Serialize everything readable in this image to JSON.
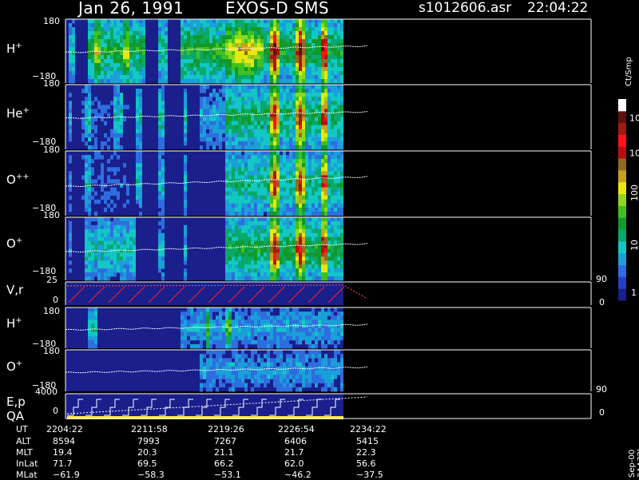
{
  "header": {
    "date": "Jan 26, 1991",
    "instrument": "EXOS-D SMS",
    "file": "s1012606.asr",
    "time": "22:04:22"
  },
  "panels": [
    {
      "id": "h1",
      "label": "H",
      "charge": "+",
      "tick_top": "180",
      "tick_bottom": "−180"
    },
    {
      "id": "he",
      "label": "He",
      "charge": "+",
      "tick_top": "180",
      "tick_bottom": "−180"
    },
    {
      "id": "opp",
      "label": "O",
      "charge": "++",
      "tick_top": "180",
      "tick_bottom": "−180"
    },
    {
      "id": "o1",
      "label": "O",
      "charge": "+",
      "tick_top": "180",
      "tick_bottom": "−180"
    },
    {
      "id": "vr",
      "label": "V,r",
      "tick_top": "25",
      "tick_bottom": "0",
      "right_top": "90",
      "right_bottom": "0"
    },
    {
      "id": "h2",
      "label": "H",
      "charge": "+",
      "tick_top": "180",
      "tick_bottom": "−180"
    },
    {
      "id": "o2",
      "label": "O",
      "charge": "+",
      "tick_top": "180",
      "tick_bottom": "−180"
    },
    {
      "id": "ep",
      "label": "E,p",
      "tick_top": "4000",
      "tick_bottom": "0",
      "right_top": "90",
      "right_bottom": "0"
    }
  ],
  "qa_label": "QA",
  "colorbar": {
    "label": "Ct/Smp",
    "ticks": [
      {
        "base": "10",
        "exp": "4"
      },
      {
        "base": "10",
        "exp": "3"
      },
      {
        "base": "100",
        "exp": ""
      },
      {
        "base": "10",
        "exp": ""
      },
      {
        "base": "1",
        "exp": ""
      }
    ],
    "colors": [
      "#1a1f8c",
      "#2540c8",
      "#2e6de0",
      "#1a9fd8",
      "#12c7c4",
      "#0aa86a",
      "#119a2a",
      "#40c020",
      "#8fd820",
      "#e8e810",
      "#c8a020",
      "#906a20",
      "#b81010",
      "#ff1414",
      "#a01a10",
      "#601010",
      "#ffffff"
    ]
  },
  "ephemeris": {
    "labels": [
      "UT",
      "ALT",
      "MLT",
      "InLat",
      "MLat"
    ],
    "columns": [
      [
        "2204:22",
        "8594",
        "19.4",
        "71.7",
        "−61.9"
      ],
      [
        "2211:58",
        "7993",
        "20.3",
        "69.5",
        "−58.3"
      ],
      [
        "2219:26",
        "7267",
        "21.1",
        "66.2",
        "−53.1"
      ],
      [
        "2226:54",
        "6406",
        "21.7",
        "62.0",
        "−46.2"
      ],
      [
        "2234:22",
        "5415",
        "22.3",
        "56.6",
        "−37.5"
      ]
    ]
  },
  "side_label": "Sep-00  2AA32L"
}
